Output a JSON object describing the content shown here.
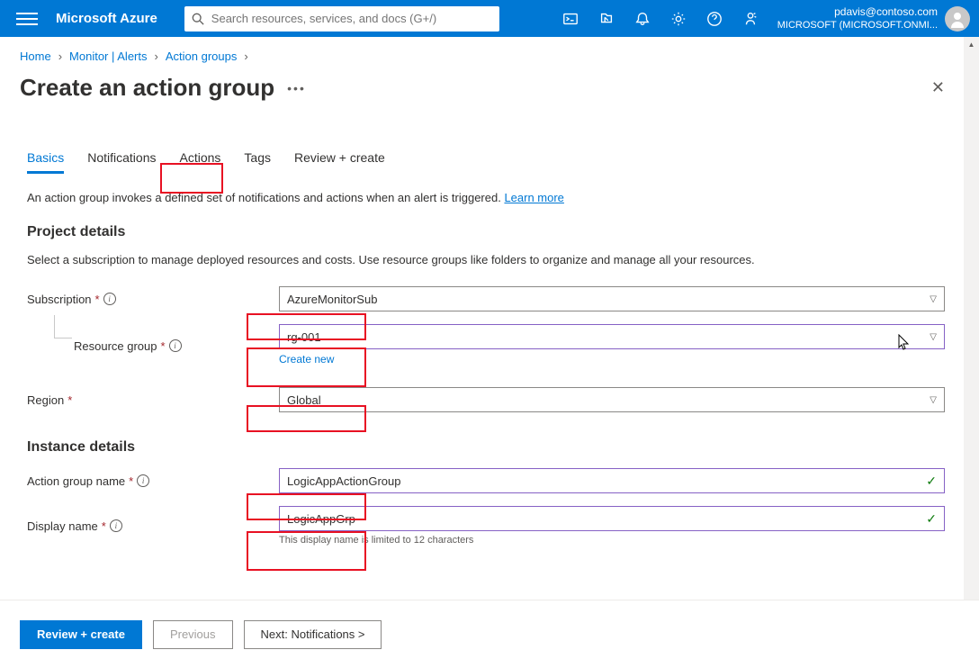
{
  "header": {
    "brand": "Microsoft Azure",
    "search_placeholder": "Search resources, services, and docs (G+/)",
    "user_email": "pdavis@contoso.com",
    "user_org": "MICROSOFT (MICROSOFT.ONMI..."
  },
  "breadcrumb": {
    "items": [
      "Home",
      "Monitor | Alerts",
      "Action groups"
    ]
  },
  "page": {
    "title": "Create an action group"
  },
  "tabs": [
    "Basics",
    "Notifications",
    "Actions",
    "Tags",
    "Review + create"
  ],
  "intro": {
    "text": "An action group invokes a defined set of notifications and actions when an alert is triggered. ",
    "link": "Learn more"
  },
  "sections": {
    "project": {
      "heading": "Project details",
      "desc": "Select a subscription to manage deployed resources and costs. Use resource groups like folders to organize and manage all your resources.",
      "subscription_label": "Subscription",
      "subscription_value": "AzureMonitorSub",
      "rg_label": "Resource group",
      "rg_value": "rg-001",
      "create_new": "Create new",
      "region_label": "Region",
      "region_value": "Global"
    },
    "instance": {
      "heading": "Instance details",
      "agname_label": "Action group name",
      "agname_value": "LogicAppActionGroup",
      "display_label": "Display name",
      "display_value": "LogicAppGrp",
      "display_hint": "This display name is limited to 12 characters"
    }
  },
  "footer": {
    "review": "Review + create",
    "prev": "Previous",
    "next": "Next: Notifications >"
  }
}
